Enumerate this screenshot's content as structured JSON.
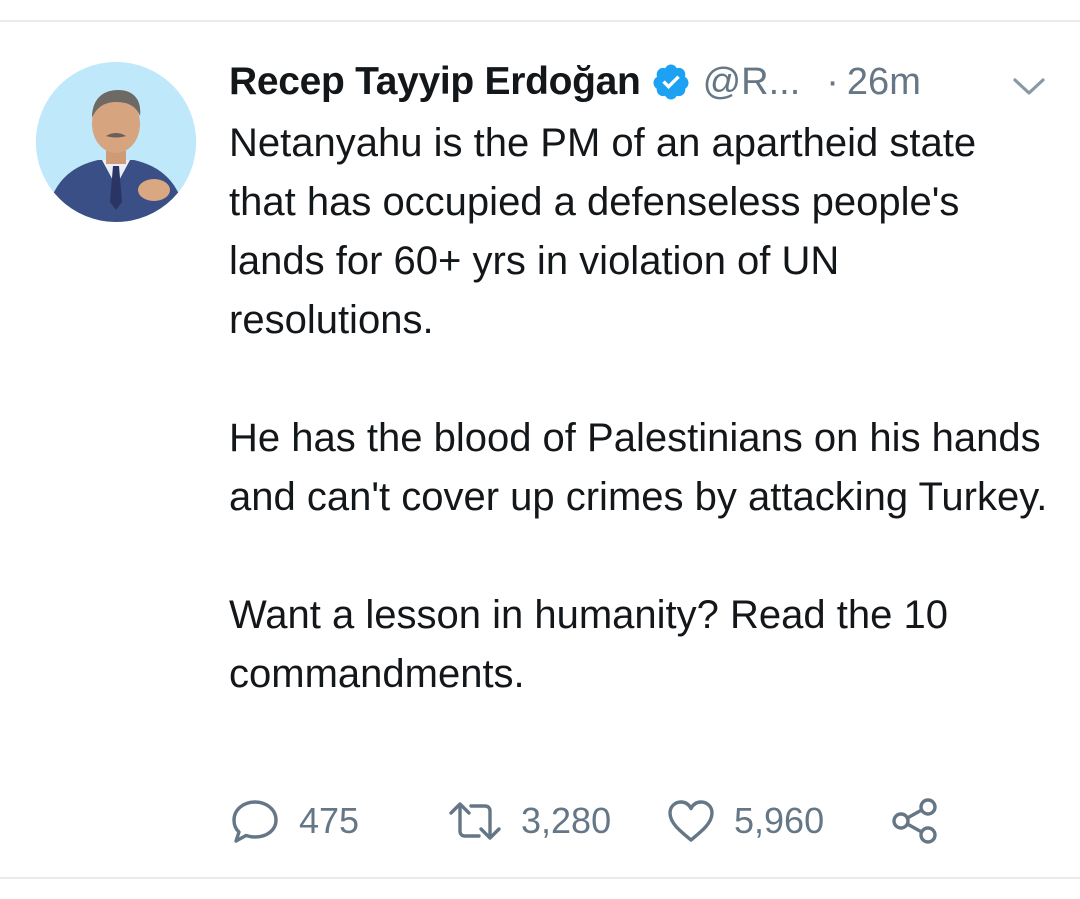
{
  "tweet": {
    "author": {
      "display_name": "Recep Tayyip Erdoğan",
      "handle": "@R...",
      "verified": true,
      "avatar_icon": "avatar-photo"
    },
    "separator": "·",
    "timestamp": "26m",
    "menu_icon": "chevron-down-icon",
    "text_paragraphs": [
      "Netanyahu is the PM of an apartheid state that has occupied a defenseless people's lands for 60+ yrs in violation of UN resolutions.",
      "He has the blood of Palestinians on his hands and can't cover up crimes by attacking Turkey.",
      "Want a lesson in humanity? Read the 10 commandments."
    ],
    "actions": {
      "reply": {
        "icon": "reply-icon",
        "count": "475"
      },
      "retweet": {
        "icon": "retweet-icon",
        "count": "3,280"
      },
      "like": {
        "icon": "heart-icon",
        "count": "5,960"
      },
      "share": {
        "icon": "share-icon"
      }
    }
  },
  "colors": {
    "text": "#14171a",
    "secondary": "#657786",
    "verified": "#1da1f2",
    "divider": "#e6ecf0"
  }
}
